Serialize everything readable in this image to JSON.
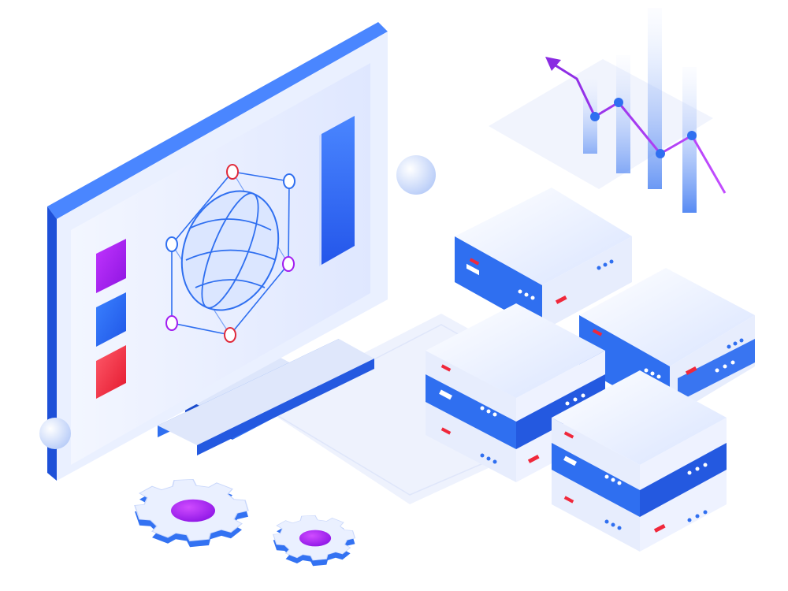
{
  "illustration": {
    "subject": "",
    "elements": {
      "monitor": "monitor",
      "globe": "globe-network",
      "chart": "trend-chart",
      "servers": "server-stack",
      "gears": "gears",
      "pins": "map-pins"
    }
  },
  "colors": {
    "background": "#ffffff",
    "primary_blue": "#2f6ff0",
    "light_blue": "#e9efff",
    "screen_fill": "#eef2ff",
    "purple": "#a21cf0",
    "red": "#f0283b",
    "chart_line": "#9b2cf0"
  },
  "screen_swatches": [
    "#a21cf0",
    "#2f6ff0",
    "#f0283b"
  ]
}
